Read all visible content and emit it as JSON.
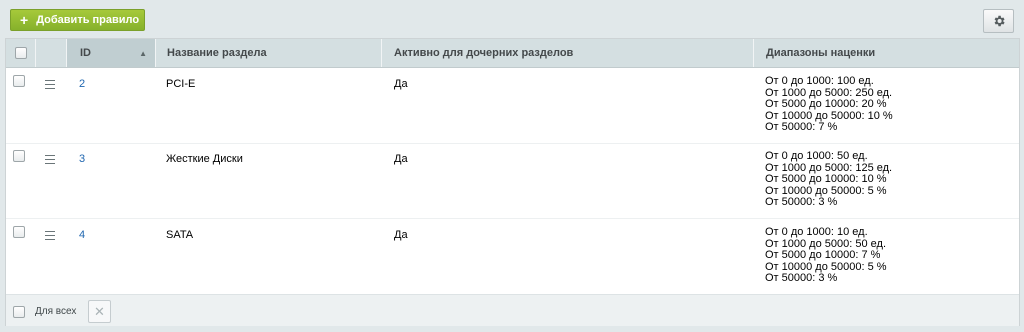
{
  "toolbar": {
    "add_label": "Добавить правило",
    "add_icon": "plus-icon",
    "settings_icon": "gear-icon"
  },
  "table": {
    "columns": [
      "ID",
      "Название раздела",
      "Активно для дочерних разделов",
      "Диапазоны наценки"
    ],
    "rows": [
      {
        "id": "2",
        "section": "PCI-E",
        "active": "Да",
        "ranges": "От 0 до 1000: 100 ед.\nОт 1000 до 5000: 250 ед.\nОт 5000 до 10000: 20 %\nОт 10000 до 50000: 10 %\nОт 50000: 7 %"
      },
      {
        "id": "3",
        "section": "Жесткие Диски",
        "active": "Да",
        "ranges": "От 0 до 1000: 50 ед.\nОт 1000 до 5000: 125 ед.\nОт 5000 до 10000: 10 %\nОт 10000 до 50000: 5 %\nОт 50000: 3 %"
      },
      {
        "id": "4",
        "section": "SATA",
        "active": "Да",
        "ranges": "От 0 до 1000: 10 ед.\nОт 1000 до 5000: 50 ед.\nОт 5000 до 10000: 7 %\nОт 10000 до 50000: 5 %\nОт 50000: 3 %"
      }
    ]
  },
  "footer": {
    "for_all_label": "Для всех",
    "delete_icon": "close-icon"
  },
  "colors": {
    "accent_green": "#8ab52e",
    "header_bg": "#d4dfe1",
    "link_blue": "#2067b0"
  }
}
